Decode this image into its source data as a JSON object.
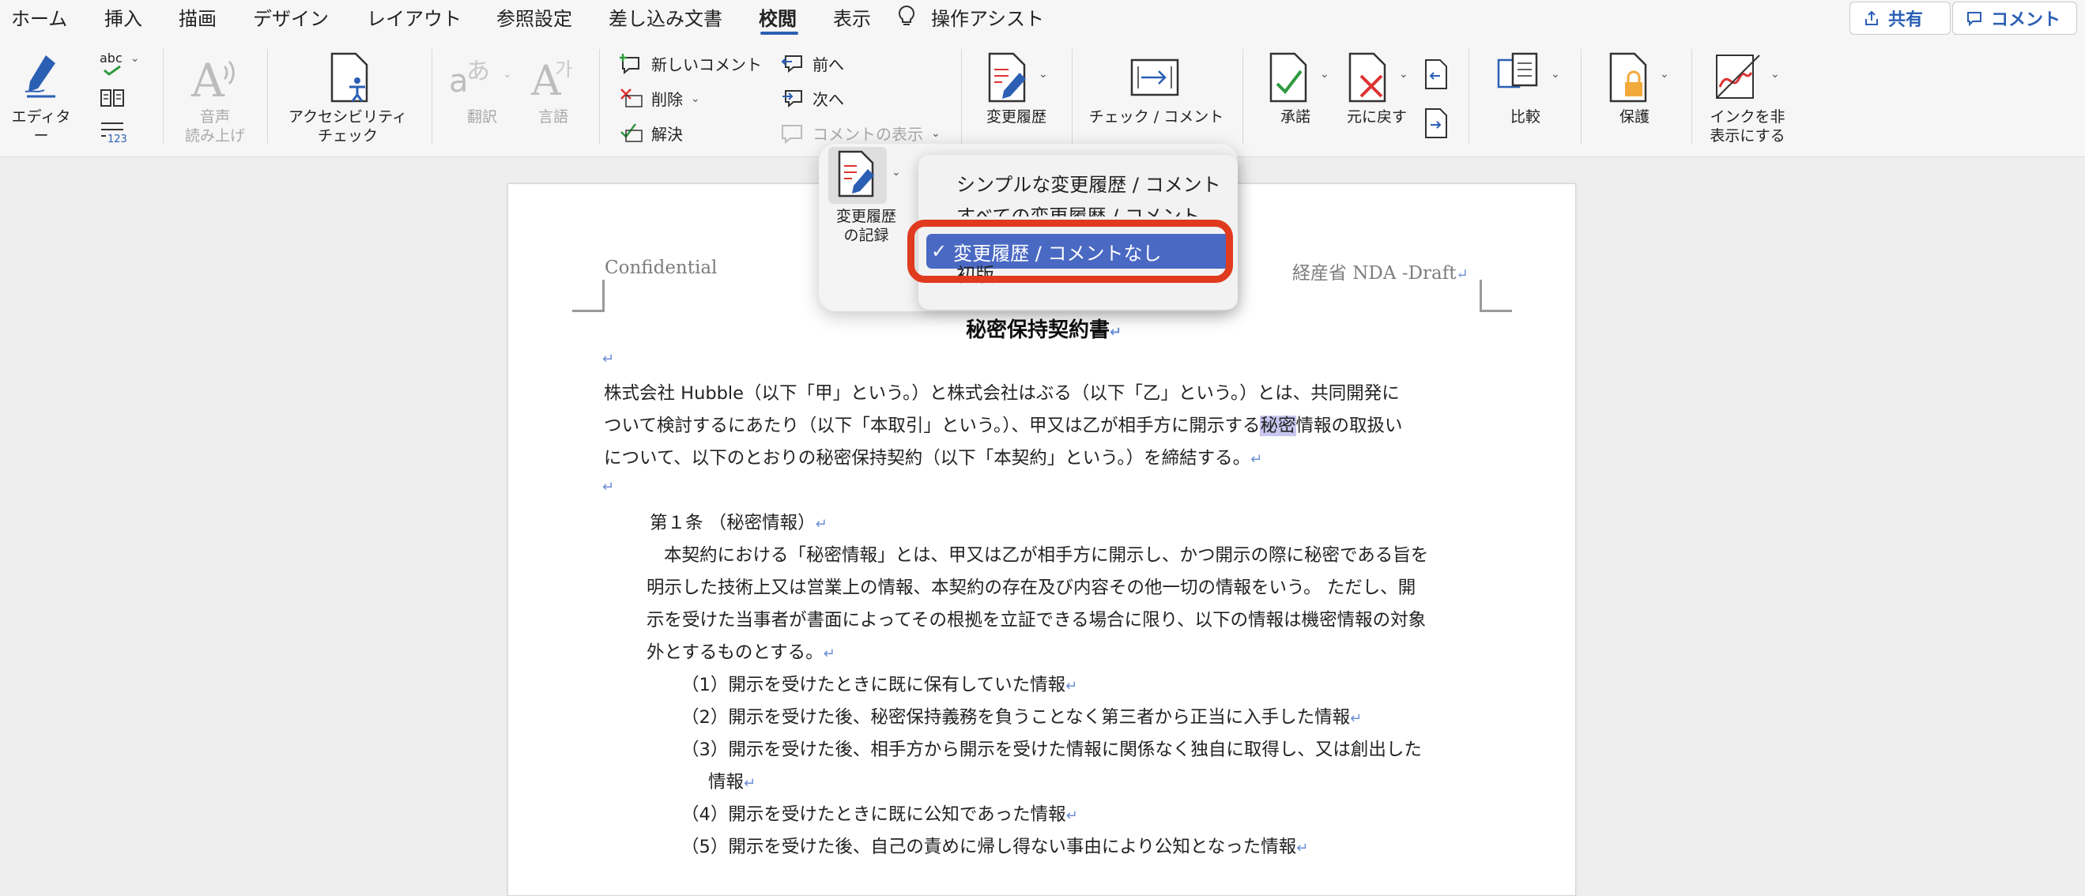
{
  "menubar": {
    "tabs": [
      "ホーム",
      "挿入",
      "描画",
      "デザイン",
      "レイアウト",
      "参照設定",
      "差し込み文書",
      "校閲",
      "表示"
    ],
    "active_tab": "校閲",
    "tell_me": "操作アシスト",
    "share_label": "共有",
    "comment_label": "コメント"
  },
  "ribbon": {
    "editor": "エディター",
    "spelling_caption": "abc",
    "read_aloud": "音声\n読み上げ",
    "accessibility": "アクセシビリティ\nチェック",
    "translate": "翻訳",
    "language": "言語",
    "new_comment": "新しいコメント",
    "delete": "削除",
    "resolve": "解決",
    "previous": "前へ",
    "next": "次へ",
    "show_comments": "コメントの表示",
    "track_changes": "変更履歴",
    "check_comment": "チェック / コメント",
    "accept": "承諾",
    "reject": "元に戻す",
    "compare": "比較",
    "protect": "保護",
    "hide_ink": "インクを非\n表示にする",
    "track_record": "変更履歴\nの記録"
  },
  "markup_menu": {
    "options": [
      "シンプルな変更履歴 / コメント",
      "すべての変更履歴 / コメント",
      "変更履歴 / コメントなし",
      "初版"
    ],
    "selected": "変更履歴 / コメントなし",
    "check": "✓"
  },
  "document": {
    "header_left": "Confidential",
    "header_right": "経産省 NDA -Draft",
    "title": "秘密保持契約書",
    "intro_line1": "株式会社 Hubble（以下「甲」という。）と株式会社はぶる（以下「乙」という。）とは、共同開発に",
    "intro_line2_a": "ついて検討するにあたり（以下「本取引」という。）、甲又は乙が相手方に開示する",
    "intro_line2_hl": "秘密",
    "intro_line2_b": "情報の取扱い",
    "intro_line3": "について、以下のとおりの秘密保持契約（以下「本契約」という。）を締結する。",
    "article1_title": "第１条 （秘密情報）",
    "article1_p1": "本契約における「秘密情報」とは、甲又は乙が相手方に開示し、かつ開示の際に秘密である旨を",
    "article1_p2": "明示した技術上又は営業上の情報、本契約の存在及び内容その他一切の情報をいう。 ただし、開",
    "article1_p3": "示を受けた当事者が書面によってその根拠を立証できる場合に限り、以下の情報は機密情報の対象",
    "article1_p4": "外とするものとする。",
    "items": [
      "（1）開示を受けたときに既に保有していた情報",
      "（2）開示を受けた後、秘密保持義務を負うことなく第三者から正当に入手した情報",
      "（3）開示を受けた後、相手方から開示を受けた情報に関係なく独自に取得し、又は創出した",
      "（4）開示を受けたときに既に公知であった情報",
      "（5）開示を受けた後、自己の責めに帰し得ない事由により公知となった情報"
    ],
    "item3_cont": "情報",
    "para_mark": "↵"
  },
  "colors": {
    "accent": "#2b5fb4",
    "selected": "#4a69c3",
    "highlight_box": "#e03a1f"
  }
}
